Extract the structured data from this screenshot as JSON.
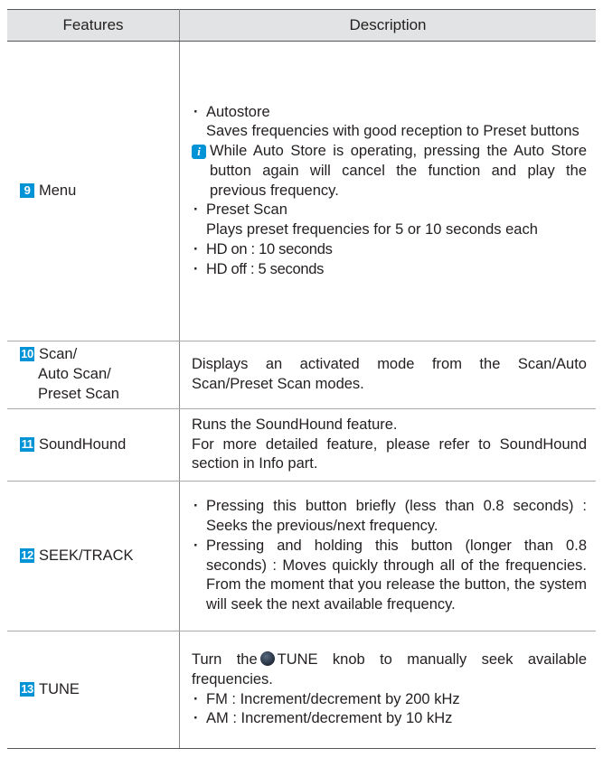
{
  "header": {
    "features": "Features",
    "description": "Description"
  },
  "rows": [
    {
      "num": "9",
      "label": "Menu",
      "desc": {
        "b1": "Autostore",
        "b1_detail": "Saves frequencies with good reception to Preset buttons",
        "note": "While Auto Store is operating, pressing the Auto Store button again will cancel the function and play the previous frequency.",
        "b2": "Preset Scan",
        "b2_detail": "Plays preset frequencies for 5 or 10 seconds each",
        "b3": "HD on : 10 seconds",
        "b4": "HD off :  5 seconds"
      }
    },
    {
      "num": "10",
      "label_l1": "Scan/",
      "label_l2": "Auto Scan/",
      "label_l3": "Preset Scan",
      "desc": {
        "text": "Displays an activated mode from the Scan/Auto Scan/Preset Scan modes."
      }
    },
    {
      "num": "11",
      "label": "SoundHound",
      "desc": {
        "l1": "Runs the SoundHound feature.",
        "l2": "For more detailed feature, please refer to SoundHound section in Info part."
      }
    },
    {
      "num": "12",
      "label": "SEEK/TRACK",
      "desc": {
        "b1": "Pressing this button briefly (less than 0.8 seconds) : Seeks the previous/next frequency.",
        "b2": "Pressing and holding this button (longer than 0.8 seconds) :  Moves quickly through all of the frequencies. From the moment that you release the button, the system will seek the next available frequency."
      }
    },
    {
      "num": "13",
      "label": "TUNE",
      "desc": {
        "pre": "Turn the",
        "post": "TUNE knob to manually seek available frequencies.",
        "b1": "FM : Increment/decrement by 200 kHz",
        "b2": "AM : Increment/decrement by 10 kHz"
      }
    }
  ],
  "icons": {
    "info": "info-icon",
    "knob": "knob-icon"
  },
  "colors": {
    "accent": "#0093d6",
    "header_bg": "#e2e3e4"
  }
}
